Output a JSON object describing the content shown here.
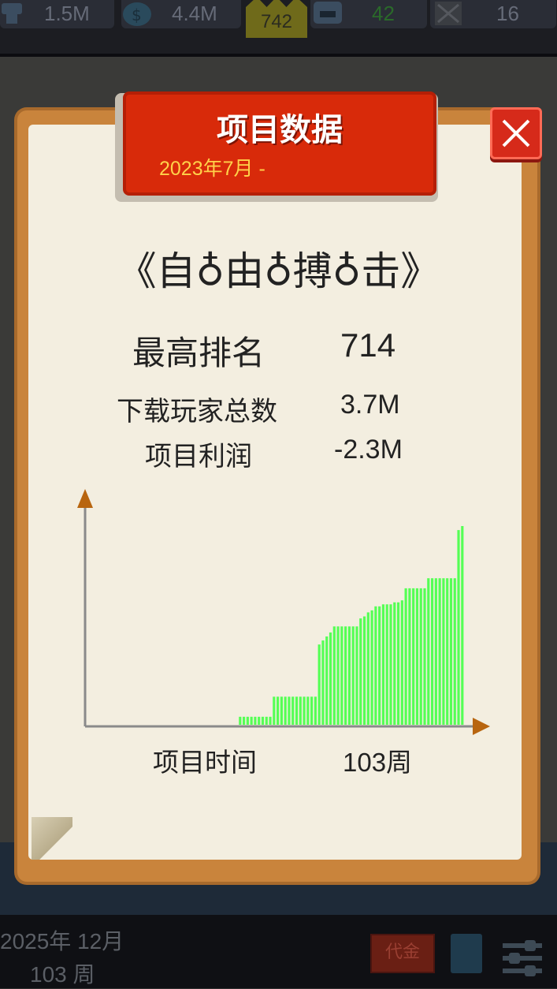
{
  "topbar": {
    "stats": [
      {
        "icon": "fans-icon",
        "value": "1.5M"
      },
      {
        "icon": "money-icon",
        "value": "4.4M"
      },
      {
        "icon": "crown-icon",
        "value": "742"
      },
      {
        "icon": "staff-icon",
        "value": "42"
      },
      {
        "icon": "bug-icon",
        "value": "16"
      }
    ]
  },
  "dialog": {
    "header_title": "项目数据",
    "header_subtitle": "2023年7月 -",
    "game_title": "《自♁由♁搏♁击》",
    "stats": {
      "highest_rank_label": "最高排名",
      "highest_rank_value": "714",
      "downloads_label": "下载玩家总数",
      "downloads_value": "3.7M",
      "profit_label": "项目利润",
      "profit_value": "-2.3M",
      "duration_label": "项目时间",
      "duration_value": "103周"
    }
  },
  "bottombar": {
    "date": "2025年 12月",
    "week": "103 周",
    "fund_label": "代金"
  },
  "colors": {
    "bar_green": "#55ff55",
    "ribbon_red": "#d82a0a",
    "arrow_brown": "#b8650f",
    "paper": "#f3eee0"
  },
  "chart_data": {
    "type": "bar",
    "x_units": "week",
    "x_count": 103,
    "values_relative": [
      0,
      0,
      0,
      0,
      0,
      0,
      0,
      0,
      0,
      0,
      0,
      0,
      0,
      0,
      0,
      0,
      0,
      0,
      0,
      0,
      0,
      0,
      0,
      0,
      0,
      0,
      0,
      0,
      0,
      0,
      0,
      0,
      0,
      0,
      0,
      0,
      0,
      0,
      0,
      0,
      4,
      4,
      4,
      4,
      4,
      4,
      4,
      4,
      4,
      14,
      14,
      14,
      14,
      14,
      14,
      14,
      14,
      14,
      14,
      14,
      14,
      40,
      42,
      44,
      46,
      49,
      49,
      49,
      49,
      49,
      49,
      49,
      53,
      54,
      56,
      57,
      59,
      59,
      60,
      60,
      60,
      61,
      61,
      62,
      68,
      68,
      68,
      68,
      68,
      68,
      73,
      73,
      73,
      73,
      73,
      73,
      73,
      73,
      97,
      99
    ],
    "xlabel": "项目时间",
    "ylabel": ""
  }
}
